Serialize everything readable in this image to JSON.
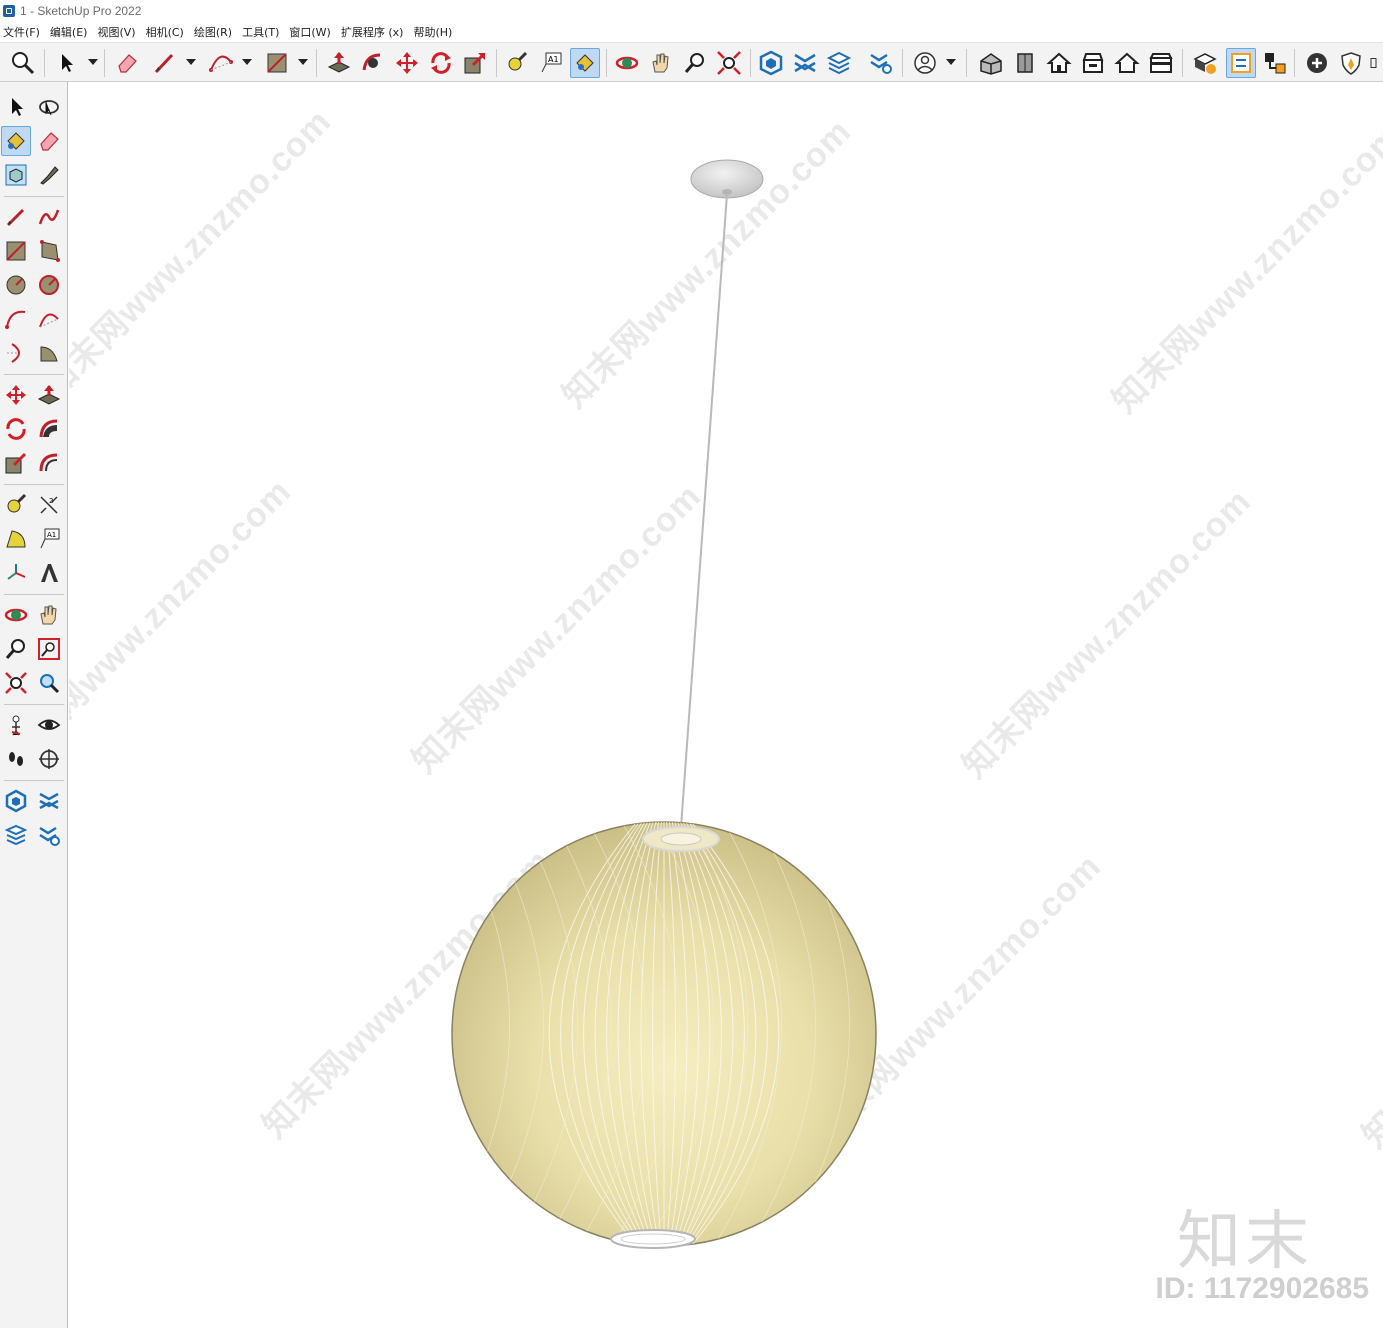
{
  "window": {
    "title": "1 - SketchUp Pro 2022"
  },
  "menu": {
    "items": [
      "文件(F)",
      "编辑(E)",
      "视图(V)",
      "相机(C)",
      "绘图(R)",
      "工具(T)",
      "窗口(W)",
      "扩展程序 (x)",
      "帮助(H)"
    ]
  },
  "toolbar": {
    "buttons": [
      "zoom",
      "select",
      "eraser",
      "pencil-line",
      "arc",
      "rectangle",
      "push-pull",
      "follow-me",
      "move",
      "rotate",
      "scale",
      "tape-measure",
      "text",
      "paint-bucket",
      "orbit",
      "pan",
      "zoom",
      "zoom-extents",
      "3d-warehouse",
      "extension-warehouse",
      "layout",
      "extension-manager",
      "profile",
      "iso-view",
      "front-view",
      "top-view",
      "right-view",
      "back-view",
      "left-view",
      "section",
      "outliner",
      "components",
      "add-location",
      "styles"
    ]
  },
  "viewport": {
    "watermark_text": "知末网www.znzmo.com",
    "logo_text": "知末",
    "id_text": "ID: 1172902685",
    "colors": {
      "lamp_body": "#efe6b8",
      "lamp_edge": "#8a8160",
      "cord": "#b9b9b9",
      "canopy": "#d2d2d2",
      "accent_blue": "#6aa7df"
    }
  }
}
